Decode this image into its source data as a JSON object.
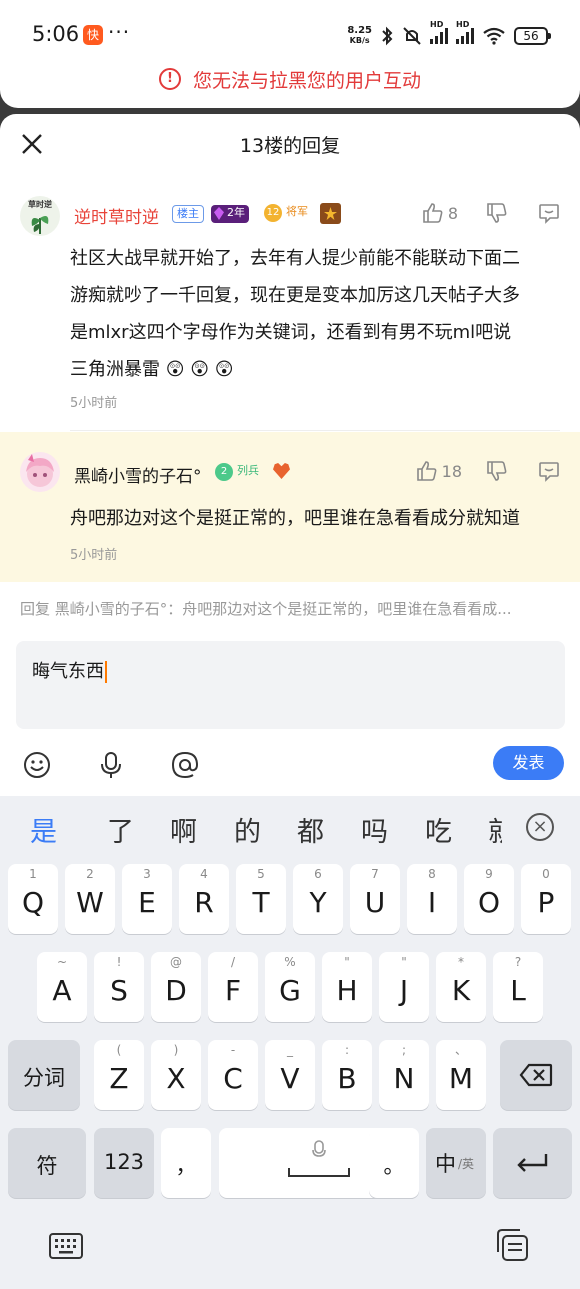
{
  "status": {
    "time": "5:06",
    "app_badge": "快",
    "more": "···",
    "speed_value": "8.25",
    "speed_unit": "KB/s",
    "sig1": "HD",
    "sig2": "HD",
    "battery": "56"
  },
  "warning": "您无法与拉黑您的用户互动",
  "sheet": {
    "title": "13楼的回复"
  },
  "main_post": {
    "username": "逆时草时逆",
    "avatar_text": "草时逆",
    "badge_owner": "楼主",
    "badge_years": "2年",
    "badge_level": "12",
    "badge_rank": "将军",
    "likes": "8",
    "lines": [
      "社区大战早就开始了，去年有人提少前能不能联动下面二",
      "游痴就吵了一千回复，现在更是变本加厉这几天帖子大多",
      "是mlxr这四个字母作为关键词，还看到有男不玩ml吧说",
      "三角洲暴雷 😲 😲 😲"
    ],
    "time": "5小时前"
  },
  "reply_post": {
    "username": "黑崎小雪的子石°",
    "badge_level": "2",
    "badge_rank": "列兵",
    "likes": "18",
    "text": "舟吧那边对这个是挺正常的，吧里谁在急看看成分就知道",
    "time": "5小时前"
  },
  "reply_hint": "回复 黑崎小雪的子石°：舟吧那边对这个是挺正常的，吧里谁在急看看成...",
  "input": {
    "value": "晦气东西"
  },
  "send_label": "发表",
  "keyboard": {
    "candidates": [
      "是",
      "了",
      "啊",
      "的",
      "都",
      "吗",
      "吃",
      "就"
    ],
    "row1": [
      {
        "k": "Q",
        "s": "1"
      },
      {
        "k": "W",
        "s": "2"
      },
      {
        "k": "E",
        "s": "3"
      },
      {
        "k": "R",
        "s": "4"
      },
      {
        "k": "T",
        "s": "5"
      },
      {
        "k": "Y",
        "s": "6"
      },
      {
        "k": "U",
        "s": "7"
      },
      {
        "k": "I",
        "s": "8"
      },
      {
        "k": "O",
        "s": "9"
      },
      {
        "k": "P",
        "s": "0"
      }
    ],
    "row2": [
      {
        "k": "A",
        "s": "~"
      },
      {
        "k": "S",
        "s": "!"
      },
      {
        "k": "D",
        "s": "@"
      },
      {
        "k": "F",
        "s": "/"
      },
      {
        "k": "G",
        "s": "%"
      },
      {
        "k": "H",
        "s": "\""
      },
      {
        "k": "J",
        "s": "\""
      },
      {
        "k": "K",
        "s": "*"
      },
      {
        "k": "L",
        "s": "?"
      }
    ],
    "row3": [
      {
        "k": "Z",
        "s": "("
      },
      {
        "k": "X",
        "s": ")"
      },
      {
        "k": "C",
        "s": "-"
      },
      {
        "k": "V",
        "s": "_"
      },
      {
        "k": "B",
        "s": ":"
      },
      {
        "k": "N",
        "s": ";"
      },
      {
        "k": "M",
        "s": "、"
      }
    ],
    "fenci": "分词",
    "fu": "符",
    "num": "123",
    "comma": "，",
    "period": "。",
    "lang_main": "中",
    "lang_sub": "/英"
  }
}
